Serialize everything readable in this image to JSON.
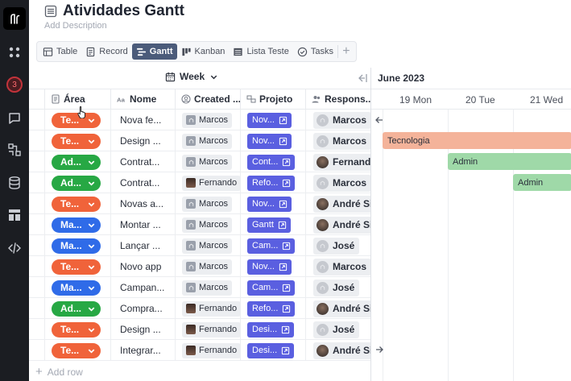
{
  "sidebar": {
    "notification_count": "3"
  },
  "header": {
    "title": "Atividades Gantt",
    "description_placeholder": "Add Description"
  },
  "tabs": [
    {
      "label": "Table",
      "icon": "table-icon"
    },
    {
      "label": "Record",
      "icon": "record-icon"
    },
    {
      "label": "Gantt",
      "icon": "gantt-icon",
      "active": true
    },
    {
      "label": "Kanban",
      "icon": "kanban-icon"
    },
    {
      "label": "Lista Teste",
      "icon": "list-icon"
    },
    {
      "label": "Tasks",
      "icon": "check-circle-icon"
    }
  ],
  "toolbar": {
    "period_label": "Week"
  },
  "columns": {
    "area": "Área",
    "nome": "Nome",
    "created": "Created ...",
    "projeto": "Projeto",
    "responsavel": "Respons..."
  },
  "colors": {
    "tecnologia": "#f0633a",
    "admin": "#27a844",
    "marketing": "#2f6be8",
    "projeto": "#5a5fe0",
    "bar_tecnologia": "#f4b39a",
    "bar_admin": "#9fd9a8"
  },
  "rows": [
    {
      "area": "Te...",
      "area_color": "#f0633a",
      "nome": "Nova fe...",
      "created": "Marcos",
      "created_photo": false,
      "projeto": "Nov...",
      "resp": "Marcos",
      "resp_photo": false
    },
    {
      "area": "Te...",
      "area_color": "#f0633a",
      "nome": "Design ...",
      "created": "Marcos",
      "created_photo": false,
      "projeto": "Nov...",
      "resp": "Marcos",
      "resp_photo": false
    },
    {
      "area": "Ad...",
      "area_color": "#27a844",
      "nome": "Contrat...",
      "created": "Marcos",
      "created_photo": false,
      "projeto": "Cont...",
      "resp": "Fernando",
      "resp_photo": true
    },
    {
      "area": "Ad...",
      "area_color": "#27a844",
      "nome": "Contrat...",
      "created": "Fernando",
      "created_photo": true,
      "projeto": "Refo...",
      "resp": "Marcos",
      "resp_photo": false
    },
    {
      "area": "Te...",
      "area_color": "#f0633a",
      "nome": "Novas a...",
      "created": "Marcos",
      "created_photo": false,
      "projeto": "Nov...",
      "resp": "André Sil",
      "resp_photo": true
    },
    {
      "area": "Ma...",
      "area_color": "#2f6be8",
      "nome": "Montar ...",
      "created": "Marcos",
      "created_photo": false,
      "projeto": "Gantt",
      "resp": "André Sil",
      "resp_photo": true
    },
    {
      "area": "Ma...",
      "area_color": "#2f6be8",
      "nome": "Lançar ...",
      "created": "Marcos",
      "created_photo": false,
      "projeto": "Cam...",
      "resp": "José",
      "resp_photo": false
    },
    {
      "area": "Te...",
      "area_color": "#f0633a",
      "nome": "Novo app",
      "created": "Marcos",
      "created_photo": false,
      "projeto": "Nov...",
      "resp": "Marcos",
      "resp_photo": false
    },
    {
      "area": "Ma...",
      "area_color": "#2f6be8",
      "nome": "Campan...",
      "created": "Marcos",
      "created_photo": false,
      "projeto": "Cam...",
      "resp": "José",
      "resp_photo": false
    },
    {
      "area": "Ad...",
      "area_color": "#27a844",
      "nome": "Compra...",
      "created": "Fernando",
      "created_photo": true,
      "projeto": "Refo...",
      "resp": "André Sil",
      "resp_photo": true
    },
    {
      "area": "Te...",
      "area_color": "#f0633a",
      "nome": "Design ...",
      "created": "Fernando",
      "created_photo": true,
      "projeto": "Desi...",
      "resp": "José",
      "resp_photo": false
    },
    {
      "area": "Te...",
      "area_color": "#f0633a",
      "nome": "Integrar...",
      "created": "Fernando",
      "created_photo": true,
      "projeto": "Desi...",
      "resp": "André Sil",
      "resp_photo": true
    }
  ],
  "add_row_label": "Add row",
  "gantt": {
    "month": "June 2023",
    "days": [
      "19 Mon",
      "20 Tue",
      "21 Wed"
    ],
    "bars": [
      {
        "label": "Tecnologia",
        "color": "#f4b39a"
      },
      {
        "label": "Admin",
        "color": "#9fd9a8"
      },
      {
        "label": "Admin",
        "color": "#9fd9a8"
      }
    ]
  }
}
